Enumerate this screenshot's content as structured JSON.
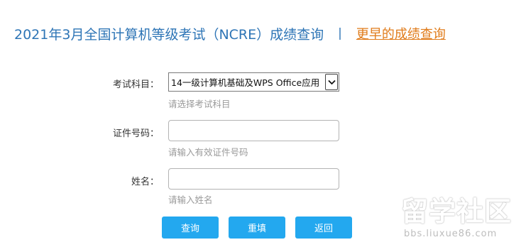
{
  "header": {
    "title": "2021年3月全国计算机等级考试（NCRE）成绩查询",
    "separator": "|",
    "earlier_link": "更早的成绩查询"
  },
  "form": {
    "subject": {
      "label": "考试科目：",
      "selected": "14一级计算机基础及WPS Office应用",
      "hint": "请选择考试科目"
    },
    "id_number": {
      "label": "证件号码：",
      "value": "",
      "hint": "请输入有效证件号码"
    },
    "name": {
      "label": "姓名：",
      "value": "",
      "hint": "请输入姓名"
    }
  },
  "buttons": {
    "query": "查询",
    "reset": "重填",
    "back": "返回"
  },
  "watermark": {
    "text": "留学社区",
    "url": "bbs.liuxue86.com"
  },
  "colors": {
    "title": "#2e75b6",
    "link": "#e07b1a",
    "button": "#23a8ef",
    "hint": "#9a9a9a"
  }
}
